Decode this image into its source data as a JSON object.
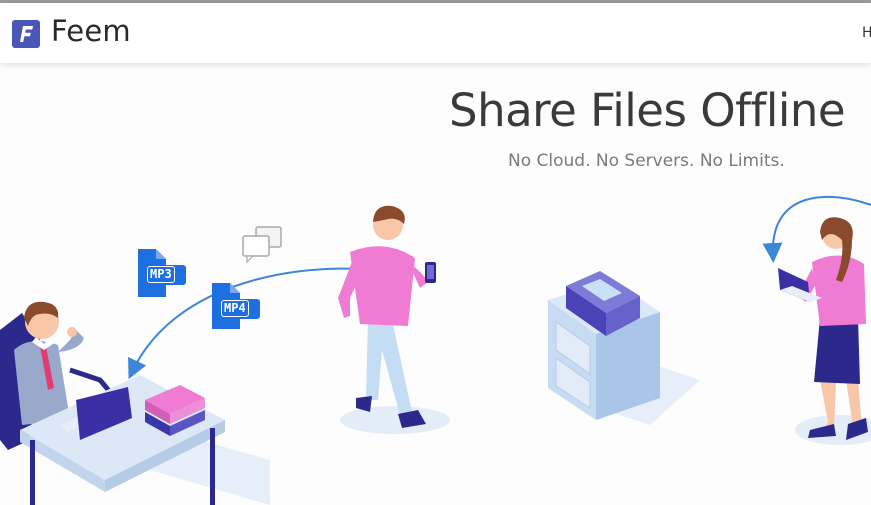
{
  "header": {
    "brand": "Feem",
    "nav_link": "H"
  },
  "hero": {
    "title": "Share Files Offline",
    "subtitle": "No Cloud. No Servers. No Limits."
  },
  "file_types": {
    "mp3": "MP3",
    "mp4": "MP4"
  },
  "icons": {
    "logo": "feem-logo-icon",
    "chat": "chat-bubbles-icon",
    "file": "audio-video-file-icon"
  },
  "colors": {
    "brand": "#4a56b8",
    "accent_pink": "#f07bd3",
    "file_blue": "#1e6fe0",
    "arrow_blue": "#3d86d8",
    "furniture": "#c7dcf2",
    "navy": "#2b2a8c"
  }
}
